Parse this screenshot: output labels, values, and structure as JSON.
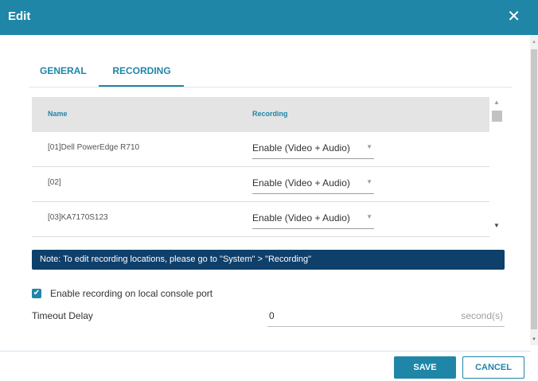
{
  "dialog": {
    "title": "Edit",
    "close_glyph": "✕"
  },
  "tabs": [
    {
      "label": "GENERAL",
      "active": false
    },
    {
      "label": "RECORDING",
      "active": true
    }
  ],
  "table": {
    "headers": {
      "name": "Name",
      "recording": "Recording"
    },
    "rows": [
      {
        "name": "[01]Dell PowerEdge R710",
        "recording": "Enable (Video + Audio)"
      },
      {
        "name": "[02]",
        "recording": "Enable (Video + Audio)"
      },
      {
        "name": "[03]KA7170S123",
        "recording": "Enable (Video + Audio)"
      }
    ]
  },
  "note": "Note: To edit recording locations, please go to \"System\" > \"Recording\"",
  "local_console": {
    "label": "Enable recording on local console port",
    "checked": true
  },
  "timeout": {
    "label": "Timeout Delay",
    "value": "0",
    "unit": "second(s)"
  },
  "buttons": {
    "save": "SAVE",
    "cancel": "CANCEL"
  },
  "colors": {
    "accent": "#1f86a8",
    "note_bg": "#0f3f6b",
    "header_bg": "#e4e4e4"
  },
  "icons": {
    "close": "close-icon",
    "dropdown": "chevron-down-icon",
    "check": "check-icon"
  }
}
